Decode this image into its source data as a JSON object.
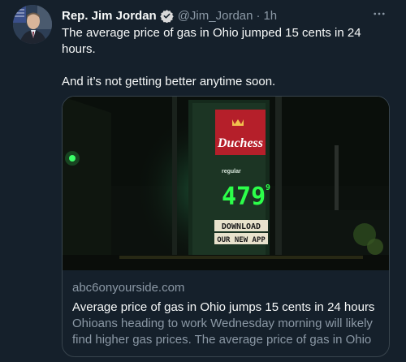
{
  "tweet": {
    "author_name": "Rep. Jim Jordan",
    "handle": "@Jim_Jordan",
    "separator": "·",
    "time": "1h",
    "more_icon": "more-horizontal-icon",
    "text_line1": "The average price of gas in Ohio jumped 15 cents in 24 hours.",
    "text_line2": "And it’s not getting better anytime soon."
  },
  "card": {
    "domain": "abc6onyourside.com",
    "title": "Average price of gas in Ohio jumps 15 cents in 24 hours",
    "description": "Ohioans heading to work Wednesday morning will likely find higher gas prices. The average price of gas in Ohio ...",
    "image": {
      "brand": "Duchess",
      "sign_label": "regular",
      "price": "479",
      "price_fraction": "9",
      "sign_line1": "DOWNLOAD",
      "sign_line2": "OUR NEW APP"
    }
  },
  "colors": {
    "background": "#15202b",
    "text_primary": "#f7f9f9",
    "text_secondary": "#8b98a5",
    "verified_blue": "#1d9bf0",
    "border": "#38444d",
    "led_green": "#2cff4a",
    "brand_red": "#c8102e"
  }
}
